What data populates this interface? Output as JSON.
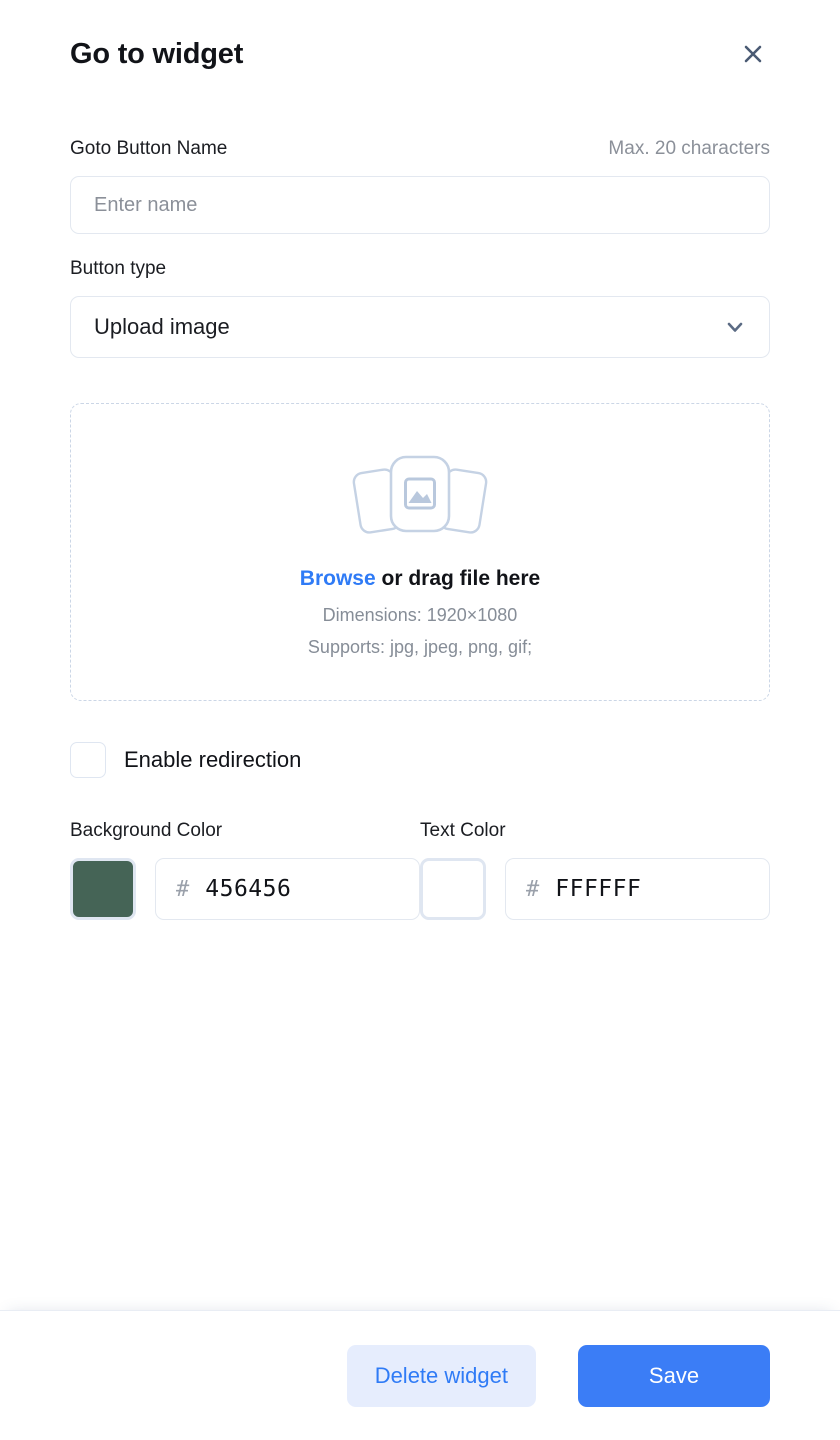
{
  "dialog": {
    "title": "Go to widget",
    "close_icon": "close-icon"
  },
  "name_field": {
    "label": "Goto Button Name",
    "hint": "Max. 20 characters",
    "placeholder": "Enter name",
    "value": ""
  },
  "button_type": {
    "label": "Button type",
    "selected": "Upload image",
    "chevron_icon": "chevron-down-icon"
  },
  "dropzone": {
    "illustration_icon": "image-upload-icon",
    "browse_label": "Browse",
    "drag_text": " or drag file here",
    "dimensions": "Dimensions: 1920×1080",
    "supports": "Supports: jpg, jpeg, png, gif;"
  },
  "redirection": {
    "label": "Enable redirection",
    "checked": false
  },
  "colors": {
    "background": {
      "label": "Background Color",
      "hash": "#",
      "hex": "456456",
      "swatch": "#456456"
    },
    "text": {
      "label": "Text Color",
      "hash": "#",
      "hex": "FFFFFF",
      "swatch": "#FFFFFF"
    }
  },
  "footer": {
    "delete_label": "Delete widget",
    "save_label": "Save"
  },
  "theme": {
    "accent": "#3b7df6",
    "accent_soft": "#e6edfd",
    "border": "#e3e8f0",
    "muted_text": "#8b9099"
  }
}
